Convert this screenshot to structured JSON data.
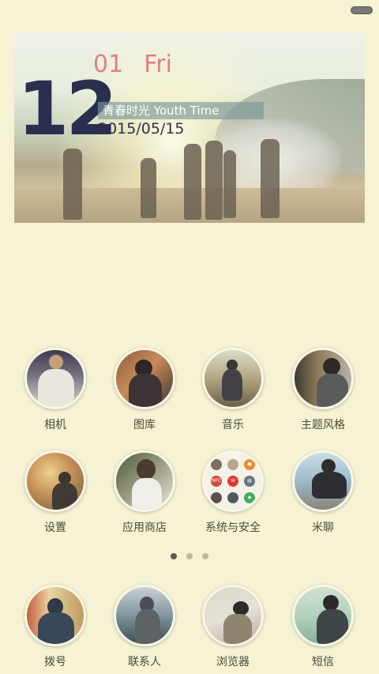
{
  "widget": {
    "day": "12",
    "month": "01",
    "weekday": "Fri",
    "tagline": "青春时光 Youth Time",
    "full_date": "2015/05/15"
  },
  "apps_page": [
    {
      "label": "相机",
      "icon": "camera-icon"
    },
    {
      "label": "图库",
      "icon": "gallery-icon"
    },
    {
      "label": "音乐",
      "icon": "music-icon"
    },
    {
      "label": "主题风格",
      "icon": "theme-icon"
    },
    {
      "label": "设置",
      "icon": "settings-icon"
    },
    {
      "label": "应用商店",
      "icon": "app-store-icon"
    },
    {
      "label": "系统与安全",
      "icon": "system-security-folder-icon"
    },
    {
      "label": "米聊",
      "icon": "miliao-icon"
    }
  ],
  "page_indicator": {
    "total": 3,
    "active": 1
  },
  "dock": [
    {
      "label": "拨号",
      "icon": "phone-icon"
    },
    {
      "label": "联系人",
      "icon": "contacts-icon"
    },
    {
      "label": "浏览器",
      "icon": "browser-icon"
    },
    {
      "label": "短信",
      "icon": "messages-icon"
    }
  ],
  "colors": {
    "background": "#f5f3d3",
    "day_number": "#2b2f4f",
    "date_accent": "#e07e82",
    "tagline_bg": "#78969a"
  }
}
